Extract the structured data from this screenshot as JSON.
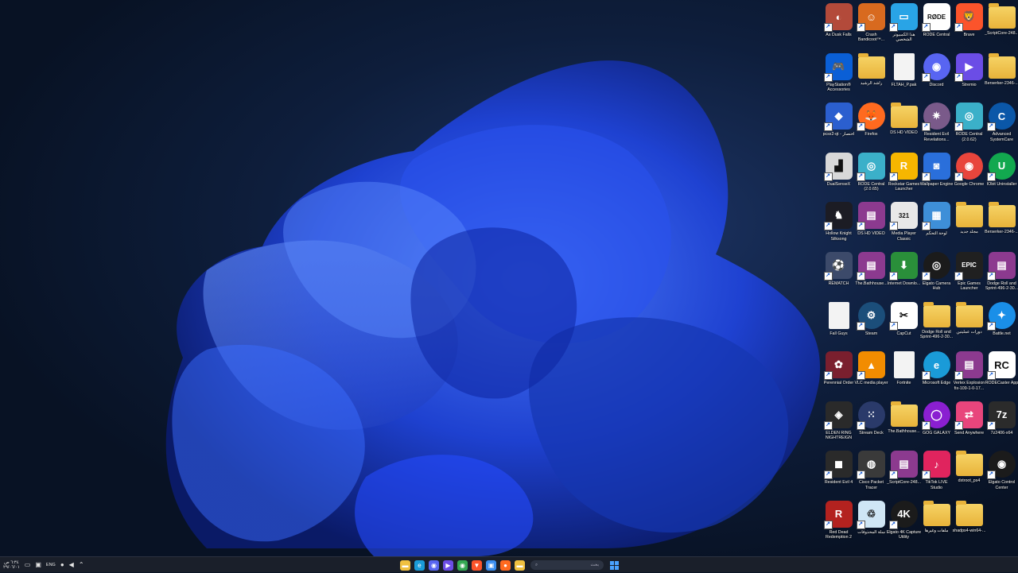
{
  "desktop": {
    "wallpaper": "windows-11-bloom",
    "accent": "#2f5bff",
    "icons": [
      {
        "label": "_ScriptCore-248...",
        "icon": "folder-icon",
        "type": "folder"
      },
      {
        "label": "Brave",
        "icon": "brave-icon",
        "type": "app",
        "color": "#fb542b",
        "glyph": "🦁"
      },
      {
        "label": "RODE Central",
        "icon": "rode-icon",
        "type": "app",
        "color": "#ffffff",
        "glyph": "RØDE",
        "dark": true
      },
      {
        "label": "هذا الكمبيوتر الشخصي",
        "icon": "monitor-icon",
        "type": "app",
        "color": "#29a4e6",
        "glyph": "▭"
      },
      {
        "label": "Crash Bandicoot™...",
        "icon": "crash-icon",
        "type": "app",
        "color": "#d86a1f",
        "glyph": "☺"
      },
      {
        "label": "As Dusk Falls",
        "icon": "as-dusk-falls-icon",
        "type": "app",
        "color": "#b34a3a",
        "glyph": "◐"
      },
      {
        "label": "Berserker-2346-...",
        "icon": "folder-zip-icon",
        "type": "folder"
      },
      {
        "label": "Stremio",
        "icon": "stremio-icon",
        "type": "app",
        "color": "#6b4de6",
        "glyph": "▶"
      },
      {
        "label": "Discord",
        "icon": "discord-icon",
        "type": "app",
        "color": "#5865f2",
        "glyph": "◉",
        "round": true
      },
      {
        "label": "FLTAH_P.pak",
        "icon": "file-icon",
        "type": "doc"
      },
      {
        "label": "راشد الرشيد",
        "icon": "user-folder-icon",
        "type": "folder"
      },
      {
        "label": "PlayStation® Accessories",
        "icon": "playstation-icon",
        "type": "app",
        "color": "#0a5fd6",
        "glyph": "🎮"
      },
      {
        "label": "Advanced SystemCare",
        "icon": "systemcare-icon",
        "type": "app",
        "color": "#0b57a8",
        "glyph": "C",
        "round": true
      },
      {
        "label": "RODE Central (2.0.62)",
        "icon": "installer-icon",
        "type": "app",
        "color": "#3bb0c9",
        "glyph": "◎"
      },
      {
        "label": "Resident Evil Revelations...",
        "icon": "re-revelations-icon",
        "type": "app",
        "color": "#7a5a8a",
        "glyph": "✷",
        "round": true
      },
      {
        "label": "DS HD VIDEO",
        "icon": "folder-icon",
        "type": "folder"
      },
      {
        "label": "Firefox",
        "icon": "firefox-icon",
        "type": "app",
        "color": "#ff6a1f",
        "glyph": "🦊",
        "round": true
      },
      {
        "label": "pcsx2-qt - اختصار",
        "icon": "pcsx2-icon",
        "type": "app",
        "color": "#2b5fcf",
        "glyph": "◆"
      },
      {
        "label": "IObit Uninstaller",
        "icon": "iobit-icon",
        "type": "app",
        "color": "#12a84f",
        "glyph": "U",
        "round": true
      },
      {
        "label": "Google Chrome",
        "icon": "chrome-icon",
        "type": "app",
        "color": "#e8453c",
        "glyph": "◉",
        "round": true
      },
      {
        "label": "Wallpaper Engine",
        "icon": "wallpaper-engine-icon",
        "type": "app",
        "color": "#2a6fdb",
        "glyph": "◙"
      },
      {
        "label": "Rockstar Games Launcher",
        "icon": "rockstar-icon",
        "type": "app",
        "color": "#f7b600",
        "glyph": "R"
      },
      {
        "label": "RODE Central (2.0.65)",
        "icon": "installer-icon",
        "type": "app",
        "color": "#3bb0c9",
        "glyph": "◎"
      },
      {
        "label": "DualSenseX",
        "icon": "dualsensex-icon",
        "type": "app",
        "color": "#d8d8d8",
        "glyph": "▟",
        "dark": true
      },
      {
        "label": "Berserker-2346-...",
        "icon": "folder-icon",
        "type": "folder"
      },
      {
        "label": "مجلد جديد",
        "icon": "folder-icon",
        "type": "folder"
      },
      {
        "label": "لوحة التحكم",
        "icon": "control-panel-icon",
        "type": "app",
        "color": "#3e8fd8",
        "glyph": "▦"
      },
      {
        "label": "Media Player Classic",
        "icon": "mpc-icon",
        "type": "app",
        "color": "#e8e8e8",
        "glyph": "321",
        "dark": true
      },
      {
        "label": "DS HD VIDEO",
        "icon": "winrar-icon",
        "type": "app",
        "color": "#8c3a8f",
        "glyph": "▤"
      },
      {
        "label": "Hollow Knight Silksong",
        "icon": "silksong-icon",
        "type": "app",
        "color": "#1c1c24",
        "glyph": "♞"
      },
      {
        "label": "Dodge Roll and Sprint-496-2-30...",
        "icon": "winrar-icon",
        "type": "app",
        "color": "#8c3a8f",
        "glyph": "▤"
      },
      {
        "label": "Epic Games Launcher",
        "icon": "epic-games-icon",
        "type": "app",
        "color": "#202020",
        "glyph": "EPIC"
      },
      {
        "label": "Elgato Camera Hub",
        "icon": "camera-hub-icon",
        "type": "app",
        "color": "#1b1b1b",
        "glyph": "◎",
        "round": true
      },
      {
        "label": "Internet Downlo...",
        "icon": "idm-icon",
        "type": "app",
        "color": "#2a8f3a",
        "glyph": "⬇"
      },
      {
        "label": "The.Bathhouse...",
        "icon": "winrar-icon",
        "type": "app",
        "color": "#8c3a8f",
        "glyph": "▤"
      },
      {
        "label": "REMATCH",
        "icon": "rematch-icon",
        "type": "app",
        "color": "#3c4a6a",
        "glyph": "⚽"
      },
      {
        "label": "Battle.net",
        "icon": "battlenet-icon",
        "type": "app",
        "color": "#1a8fe8",
        "glyph": "✦",
        "round": true
      },
      {
        "label": "دورات عمليتين",
        "icon": "folder-icon",
        "type": "folder"
      },
      {
        "label": "Dodge Roll and Sprint-496-2-30...",
        "icon": "folder-icon",
        "type": "folder"
      },
      {
        "label": "CapCut",
        "icon": "capcut-icon",
        "type": "app",
        "color": "#ffffff",
        "glyph": "✂",
        "dark": true
      },
      {
        "label": "Steam",
        "icon": "steam-icon",
        "type": "app",
        "color": "#1b4e7a",
        "glyph": "⚙",
        "round": true
      },
      {
        "label": "Fall Guys",
        "icon": "file-icon",
        "type": "doc"
      },
      {
        "label": "RODECaster App",
        "icon": "rodecaster-icon",
        "type": "app",
        "color": "#ffffff",
        "glyph": "RC",
        "dark": true
      },
      {
        "label": "Vertex Explosion fix-109-1-0-17...",
        "icon": "winrar-icon",
        "type": "app",
        "color": "#8c3a8f",
        "glyph": "▤"
      },
      {
        "label": "Microsoft Edge",
        "icon": "edge-icon",
        "type": "app",
        "color": "#1a9bd8",
        "glyph": "e",
        "round": true
      },
      {
        "label": "Fortnite",
        "icon": "file-icon",
        "type": "doc"
      },
      {
        "label": "VLC media player",
        "icon": "vlc-icon",
        "type": "app",
        "color": "#f28c00",
        "glyph": "▲"
      },
      {
        "label": "Perennial Order",
        "icon": "perennial-order-icon",
        "type": "app",
        "color": "#7a1f2e",
        "glyph": "✿"
      },
      {
        "label": "7z2406-x64",
        "icon": "7zip-icon",
        "type": "app",
        "color": "#2b2b2b",
        "glyph": "7z"
      },
      {
        "label": "Send Anywhere",
        "icon": "send-anywhere-icon",
        "type": "app",
        "color": "#e8457c",
        "glyph": "⇄"
      },
      {
        "label": "GOG GALAXY",
        "icon": "gog-icon",
        "type": "app",
        "color": "#8a1fd1",
        "glyph": "◯",
        "round": true
      },
      {
        "label": "The.Bathhouse...",
        "icon": "folder-icon",
        "type": "folder"
      },
      {
        "label": "Stream Deck",
        "icon": "stream-deck-icon",
        "type": "app",
        "color": "#2a3a6a",
        "glyph": "⁙",
        "round": true
      },
      {
        "label": "ELDEN RING NIGHTREIGN",
        "icon": "elden-ring-icon",
        "type": "app",
        "color": "#2a2a2a",
        "glyph": "◈"
      },
      {
        "label": "Elgato Control Center",
        "icon": "control-center-icon",
        "type": "app",
        "color": "#1b1b1b",
        "glyph": "◉",
        "round": true
      },
      {
        "label": "dxtroot_ps4",
        "icon": "folder-icon",
        "type": "folder"
      },
      {
        "label": "TikTok LIVE Studio",
        "icon": "tiktok-icon",
        "type": "app",
        "color": "#e0245e",
        "glyph": "♪"
      },
      {
        "label": "_ScriptCore-248...",
        "icon": "winrar-icon",
        "type": "app",
        "color": "#8c3a8f",
        "glyph": "▤"
      },
      {
        "label": "Cisco Packet Tracer",
        "icon": "packet-tracer-icon",
        "type": "app",
        "color": "#3a3a3a",
        "glyph": "◍"
      },
      {
        "label": "Resident Evil 4",
        "icon": "re4-icon",
        "type": "app",
        "color": "#2a2a2a",
        "glyph": "◼"
      },
      {
        "label": "",
        "icon": "blank",
        "type": "blank"
      },
      {
        "label": "shadps4-win64-...",
        "icon": "folder-icon",
        "type": "folder"
      },
      {
        "label": "ملفات وغيرها",
        "icon": "folder-icon",
        "type": "folder"
      },
      {
        "label": "Elgato 4K Capture Utility",
        "icon": "capture-4k-icon",
        "type": "app",
        "color": "#1b1b1b",
        "glyph": "4K",
        "round": true
      },
      {
        "label": "سلة المحذوفات",
        "icon": "recycle-bin-icon",
        "type": "app",
        "color": "#cfe6f5",
        "glyph": "♲",
        "dark": true
      },
      {
        "label": "Red Dead Redemption 2",
        "icon": "rdr2-icon",
        "type": "app",
        "color": "#b3221f",
        "glyph": "R"
      }
    ]
  },
  "taskbar": {
    "time": "٦:٣٤ ص",
    "date": "٢٩/٠٦/٠١",
    "language": "ENG",
    "search_placeholder": "بحث",
    "apps": [
      {
        "name": "file-explorer-taskbar-icon",
        "color": "#f0c040",
        "glyph": "▬"
      },
      {
        "name": "edge-taskbar-icon",
        "color": "#1a9bd8",
        "glyph": "e"
      },
      {
        "name": "discord-taskbar-icon",
        "color": "#5865f2",
        "glyph": "◉"
      },
      {
        "name": "stremio-taskbar-icon",
        "color": "#6b4de6",
        "glyph": "▶"
      },
      {
        "name": "chrome-taskbar-icon",
        "color": "#34a853",
        "glyph": "◉"
      },
      {
        "name": "brave-taskbar-icon",
        "color": "#fb542b",
        "glyph": "▼"
      },
      {
        "name": "store-taskbar-icon",
        "color": "#3b8ef0",
        "glyph": "▣"
      },
      {
        "name": "firefox-taskbar-icon",
        "color": "#ff6a1f",
        "glyph": "●"
      },
      {
        "name": "folder-taskbar-icon",
        "color": "#f0c040",
        "glyph": "▬"
      }
    ]
  }
}
